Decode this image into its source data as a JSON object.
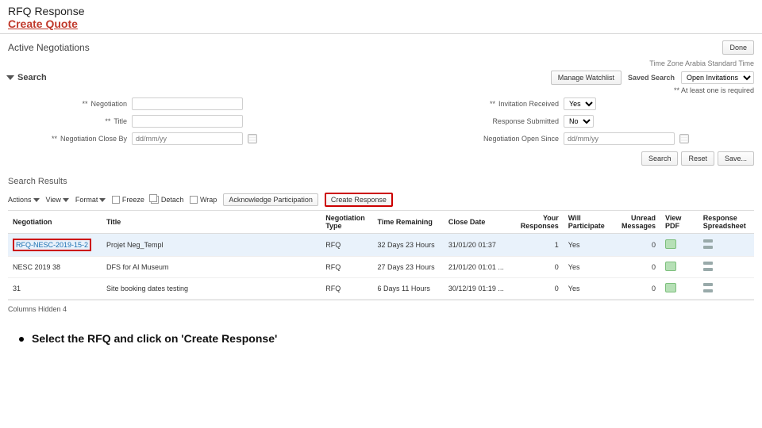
{
  "doc": {
    "heading": "RFQ Response",
    "subheading": "Create Quote",
    "instruction": "Select the RFQ and click on 'Create Response'"
  },
  "page": {
    "title": "Active Negotiations",
    "done_label": "Done",
    "manage_watchlist_label": "Manage Watchlist",
    "timezone_text": "Time Zone  Arabia Standard Time",
    "saved_search_label": "Saved Search",
    "saved_search_value": "Open Invitations",
    "required_hint": "** At least one is required"
  },
  "search": {
    "section_label": "Search",
    "negotiation_label": "Negotiation",
    "title_label": "Title",
    "close_by_label": "Negotiation Close By",
    "close_by_placeholder": "dd/mm/yy",
    "invitation_received_label": "Invitation Received",
    "invitation_received_value": "Yes",
    "response_submitted_label": "Response Submitted",
    "response_submitted_value": "No",
    "open_since_label": "Negotiation Open Since",
    "open_since_placeholder": "dd/mm/yy",
    "search_btn": "Search",
    "reset_btn": "Reset",
    "save_btn": "Save..."
  },
  "results": {
    "header": "Search Results",
    "toolbar": {
      "actions": "Actions",
      "view": "View",
      "format": "Format",
      "freeze": "Freeze",
      "detach": "Detach",
      "wrap": "Wrap",
      "ack": "Acknowledge Participation",
      "create_response": "Create Response"
    },
    "columns": {
      "negotiation": "Negotiation",
      "title": "Title",
      "neg_type": "Negotiation Type",
      "time_remaining": "Time Remaining",
      "close_date": "Close Date",
      "your_responses": "Your Responses",
      "will_participate": "Will Participate",
      "unread_messages": "Unread Messages",
      "view_pdf": "View PDF",
      "response_spreadsheet": "Response Spreadsheet"
    },
    "rows": [
      {
        "negotiation": "RFQ-NESC-2019-15-2",
        "title": "Projet Neg_Templ",
        "neg_type": "RFQ",
        "time_remaining": "32 Days 23 Hours",
        "close_date": "31/01/20 01:37",
        "your_responses": "1",
        "will_participate": "Yes",
        "unread_messages": "0"
      },
      {
        "negotiation": "NESC 2019 38",
        "title": "DFS for AI Museum",
        "neg_type": "RFQ",
        "time_remaining": "27 Days 23 Hours",
        "close_date": "21/01/20 01:01 ...",
        "your_responses": "0",
        "will_participate": "Yes",
        "unread_messages": "0"
      },
      {
        "negotiation": "31",
        "title": "Site booking dates testing",
        "neg_type": "RFQ",
        "time_remaining": "6 Days 11 Hours",
        "close_date": "30/12/19 01:19 ...",
        "your_responses": "0",
        "will_participate": "Yes",
        "unread_messages": "0"
      }
    ],
    "hidden_cols": "Columns Hidden  4"
  }
}
